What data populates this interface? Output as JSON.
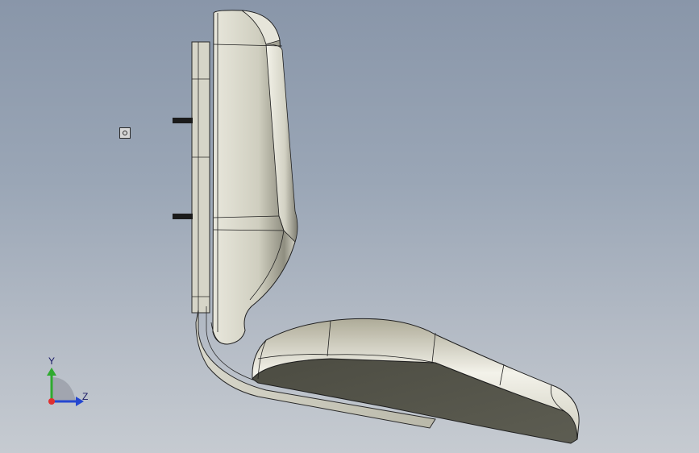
{
  "viewport": {
    "background_top": "#8996a9",
    "background_bottom": "#c6cbd1"
  },
  "model": {
    "name": "seat-chair-model",
    "parts": [
      "backrest",
      "seat-cushion",
      "support-bracket",
      "mounting-plate",
      "mounting-bolt",
      "mounting-bolt"
    ]
  },
  "colors": {
    "part_body": "#c9c8b8",
    "part_shadow": "#55554a",
    "edge": "#1f1f1f",
    "axis_x": "#e03030",
    "axis_y": "#2faa2f",
    "axis_z": "#2547d0"
  },
  "triad": {
    "y_label": "Y",
    "z_label": "Z"
  },
  "origin_marker": {
    "icon": "origin-icon"
  }
}
